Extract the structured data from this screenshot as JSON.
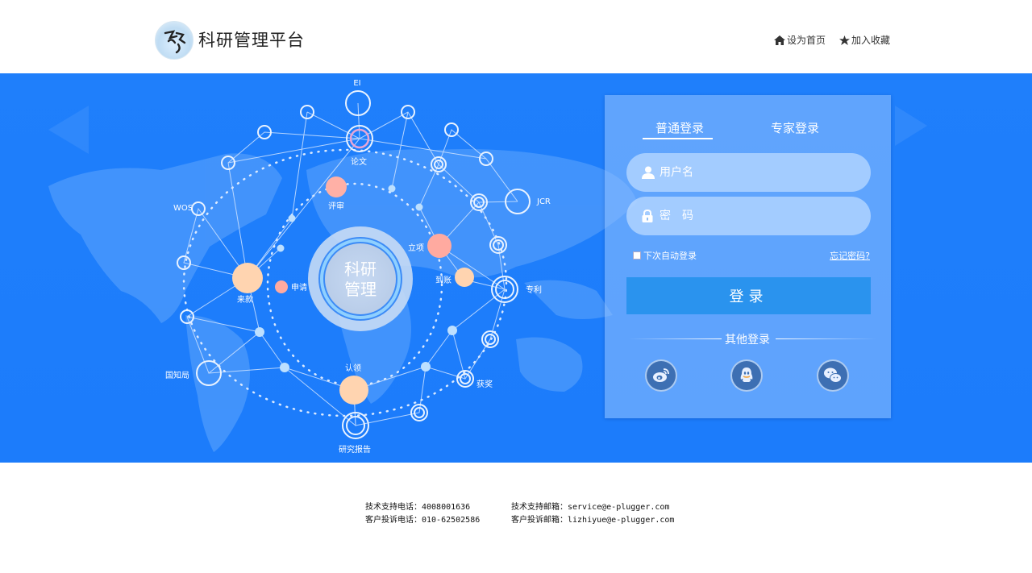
{
  "header": {
    "brand": "科研管理平台",
    "links": [
      {
        "label": "设为首页",
        "icon": "home-icon"
      },
      {
        "label": "加入收藏",
        "icon": "star-icon"
      }
    ]
  },
  "banner": {
    "center_label_line1": "科研",
    "center_label_line2": "管理",
    "nodes": {
      "ei": "EI",
      "lunwen": "论文",
      "jcr": "JCR",
      "wos": "WOS",
      "pingshen": "评审",
      "lixiang": "立项",
      "daozhang": "到账",
      "zhuanli": "专利",
      "shenqing": "申请",
      "laikuan": "来款",
      "guozhiju": "国知局",
      "renling": "认领",
      "huojiang": "获奖",
      "yanjiubaogao": "研究报告"
    }
  },
  "login": {
    "tabs": [
      "普通登录",
      "专家登录"
    ],
    "active_tab": 0,
    "username_placeholder": "用户名",
    "password_placeholder": "密　码",
    "remember_label": "下次自动登录",
    "forgot_label": "忘记密码?",
    "submit_label": "登录",
    "other_login_label": "其他登录",
    "social": [
      "weibo-icon",
      "qq-icon",
      "wechat-icon"
    ]
  },
  "footer": {
    "tech_phone": "技术支持电话：4008001636",
    "complaint_phone": "客户投诉电话：010-62502586",
    "tech_email": "技术支持邮箱：service@e-plugger.com",
    "complaint_email": "客户投诉邮箱：lizhiyue@e-plugger.com"
  },
  "colors": {
    "banner": "#1f7ffb",
    "button": "#2a93ee",
    "node_peach": "#ffd4b0",
    "node_pink": "#ffaaa0"
  }
}
